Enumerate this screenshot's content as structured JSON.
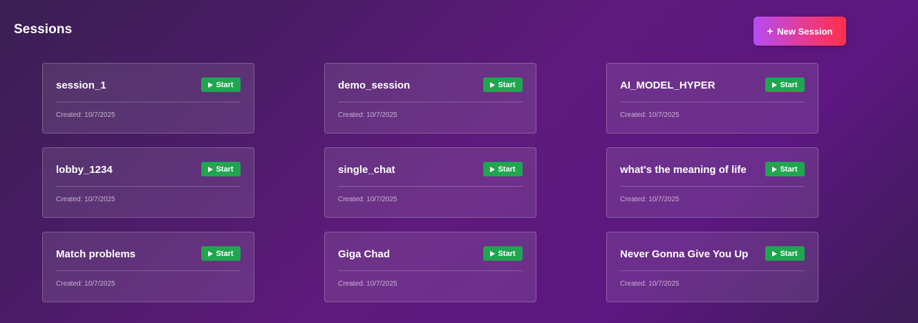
{
  "header": {
    "title": "Sessions",
    "new_session_label": "New Session",
    "new_session_icon": "+"
  },
  "sessions": [
    {
      "name": "session_1",
      "created": "Created: 10/7/2025",
      "start_label": "Start"
    },
    {
      "name": "demo_session",
      "created": "Created: 10/7/2025",
      "start_label": "Start"
    },
    {
      "name": "AI_MODEL_HYPER",
      "created": "Created: 10/7/2025",
      "start_label": "Start"
    },
    {
      "name": "lobby_1234",
      "created": "Created: 10/7/2025",
      "start_label": "Start"
    },
    {
      "name": "single_chat",
      "created": "Created: 10/7/2025",
      "start_label": "Start"
    },
    {
      "name": "what's the meaning of life",
      "created": "Created: 10/7/2025",
      "start_label": "Start"
    },
    {
      "name": "Match problems",
      "created": "Created: 10/7/2025",
      "start_label": "Start"
    },
    {
      "name": "Giga Chad",
      "created": "Created: 10/7/2025",
      "start_label": "Start"
    },
    {
      "name": "Never Gonna Give You Up",
      "created": "Created: 10/7/2025",
      "start_label": "Start"
    }
  ],
  "colors": {
    "start_button": "#1fa64f",
    "new_session_gradient_start": "#b44cf5",
    "new_session_gradient_end": "#ff3047"
  }
}
